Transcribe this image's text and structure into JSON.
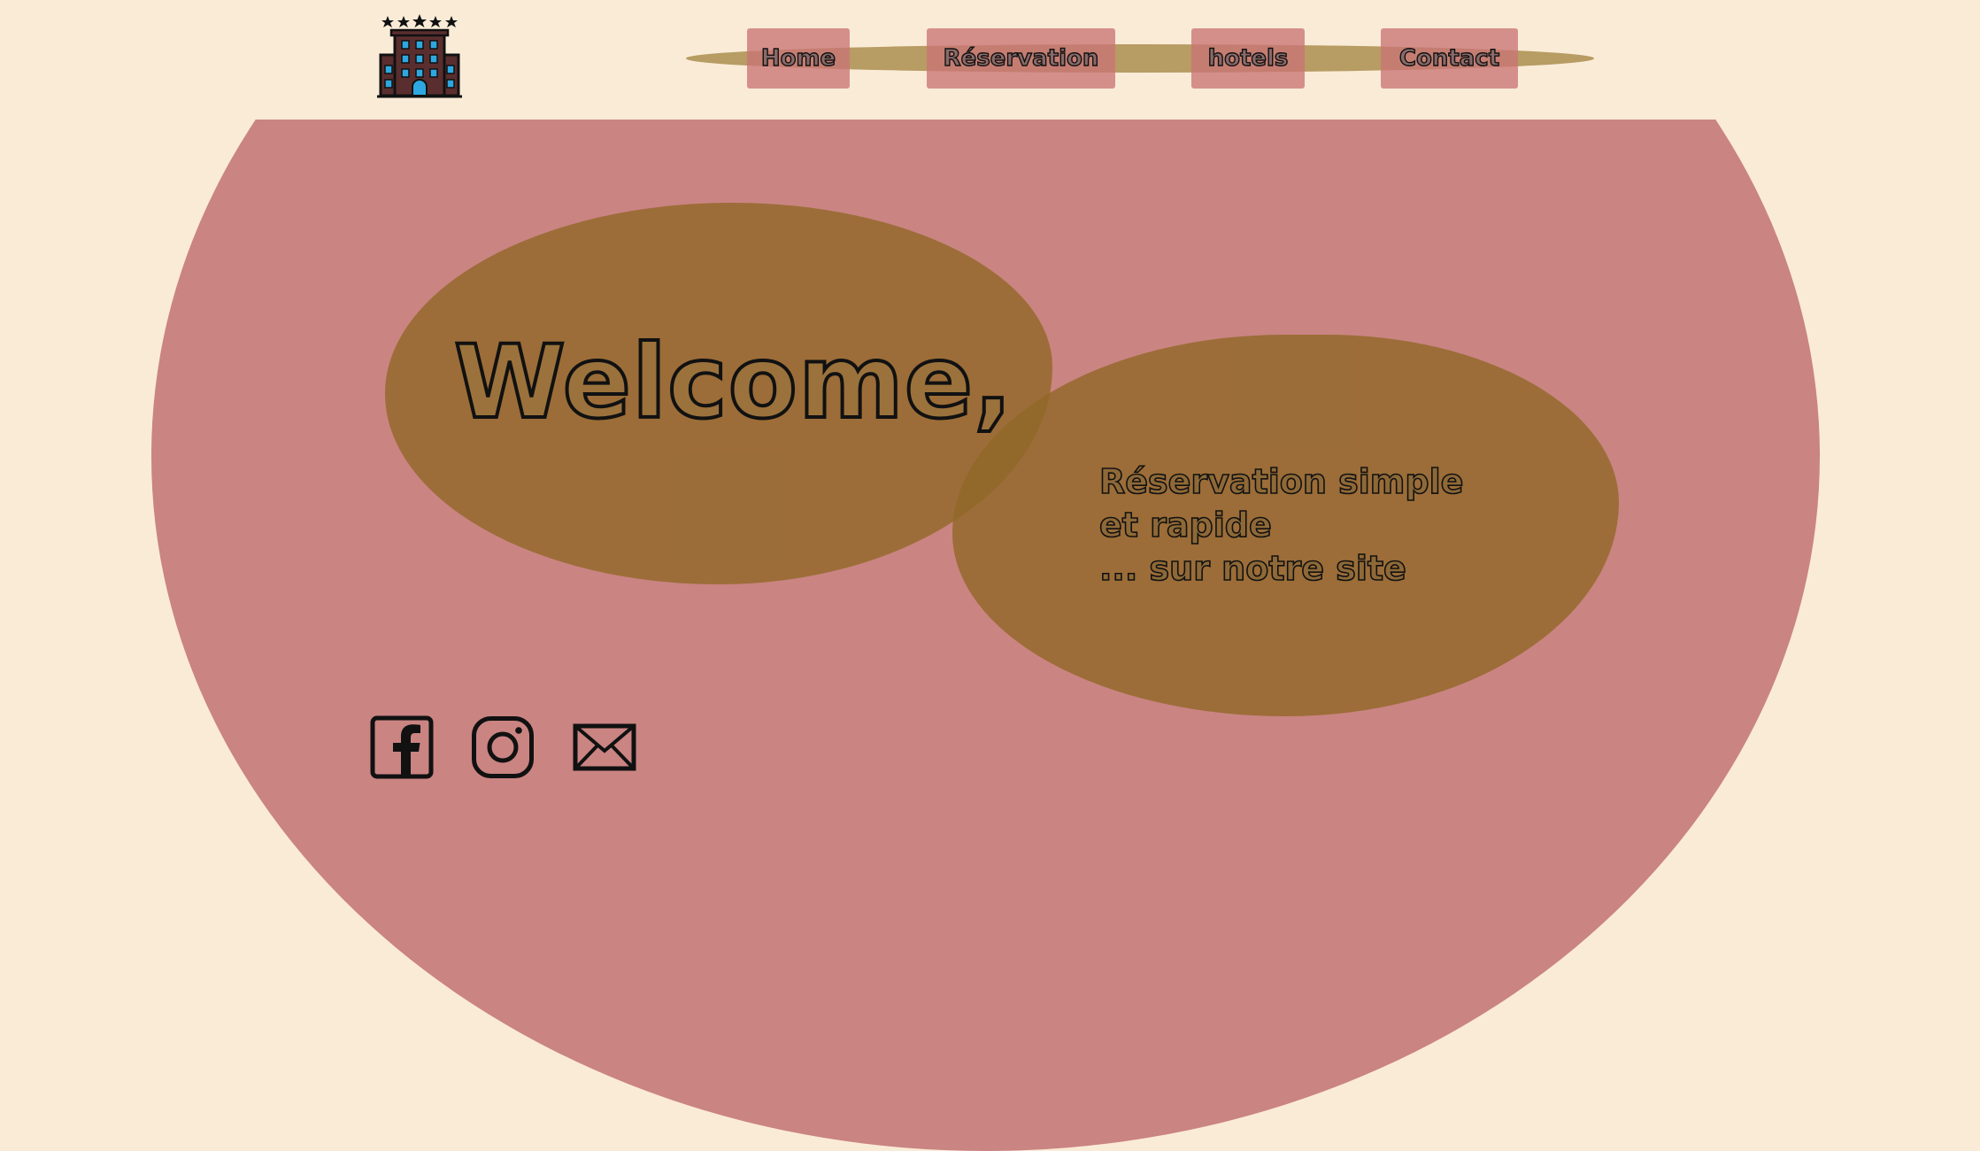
{
  "header": {
    "logo_icon": "hotel-building-with-stars-icon",
    "nav": {
      "home": "Home",
      "reservation": "Réservation",
      "hotels": "hotels",
      "contact": "Contact"
    }
  },
  "hero": {
    "title": "Welcome,",
    "tagline": {
      "line1": "Réservation simple",
      "line2": "et rapide",
      "line3": "... sur notre site"
    }
  },
  "social": {
    "icons": [
      "facebook-icon",
      "instagram-icon",
      "mail-icon"
    ]
  },
  "colors": {
    "background": "#faebd7",
    "hero": "#ca8482",
    "blob": "#916828",
    "nav_band": "#b79c63",
    "nav_button": "#cb7474"
  }
}
